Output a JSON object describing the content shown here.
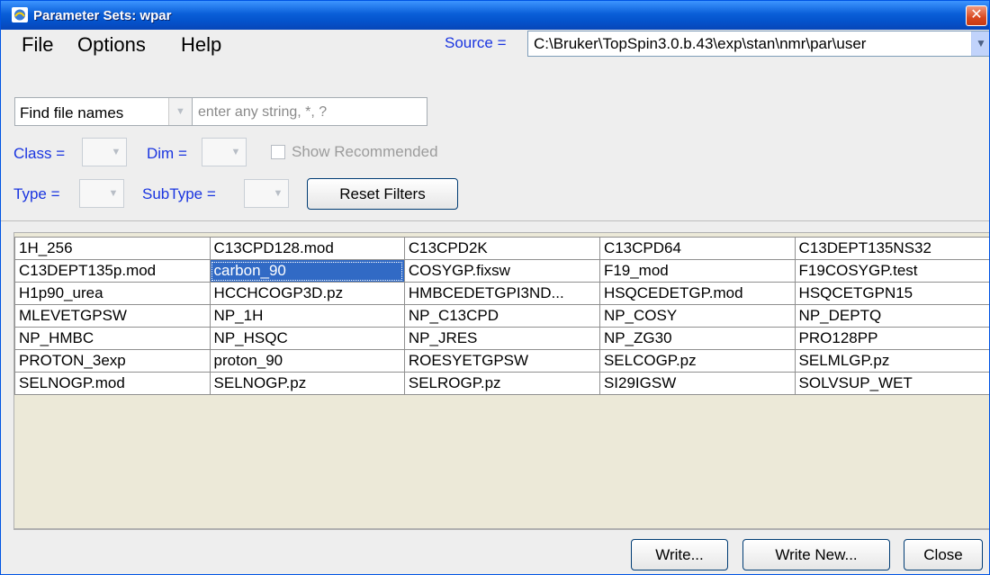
{
  "window": {
    "title": "Parameter Sets: wpar",
    "close_glyph": "✕"
  },
  "menu": {
    "items": [
      "File",
      "Options",
      "Help"
    ]
  },
  "source": {
    "label": "Source =",
    "value": "C:\\Bruker\\TopSpin3.0.b.43\\exp\\stan\\nmr\\par\\user"
  },
  "search": {
    "mode_value": "Find file names",
    "placeholder": "enter any string, *, ?"
  },
  "filters": {
    "class_label": "Class =",
    "dim_label": "Dim =",
    "show_recommended_label": "Show Recommended",
    "show_recommended_checked": false,
    "type_label": "Type =",
    "subtype_label": "SubType =",
    "reset_label": "Reset Filters"
  },
  "files": {
    "selected": "carbon_90",
    "rows": [
      [
        "1H_256",
        "C13CPD128.mod",
        "C13CPD2K",
        "C13CPD64",
        "C13DEPT135NS32"
      ],
      [
        "C13DEPT135p.mod",
        "carbon_90",
        "COSYGP.fixsw",
        "F19_mod",
        "F19COSYGP.test"
      ],
      [
        "H1p90_urea",
        "HCCHCOGP3D.pz",
        "HMBCEDETGPI3ND...",
        "HSQCEDETGP.mod",
        "HSQCETGPN15"
      ],
      [
        "MLEVETGPSW",
        "NP_1H",
        "NP_C13CPD",
        "NP_COSY",
        "NP_DEPTQ"
      ],
      [
        "NP_HMBC",
        "NP_HSQC",
        "NP_JRES",
        "NP_ZG30",
        "PRO128PP"
      ],
      [
        "PROTON_3exp",
        "proton_90",
        "ROESYETGPSW",
        "SELCOGP.pz",
        "SELMLGP.pz"
      ],
      [
        "SELNOGP.mod",
        "SELNOGP.pz",
        "SELROGP.pz",
        "SI29IGSW",
        "SOLVSUP_WET"
      ]
    ]
  },
  "buttons": {
    "write": "Write...",
    "write_new": "Write New...",
    "close": "Close"
  },
  "colors": {
    "title_bar": "#0a5fd8",
    "label_blue": "#1a35e0",
    "selection": "#316ac5",
    "close_red": "#d9481f"
  },
  "icons": {
    "title": "topspin-app-icon",
    "combo_arrow": "chevron-down-icon",
    "close": "close-icon"
  }
}
